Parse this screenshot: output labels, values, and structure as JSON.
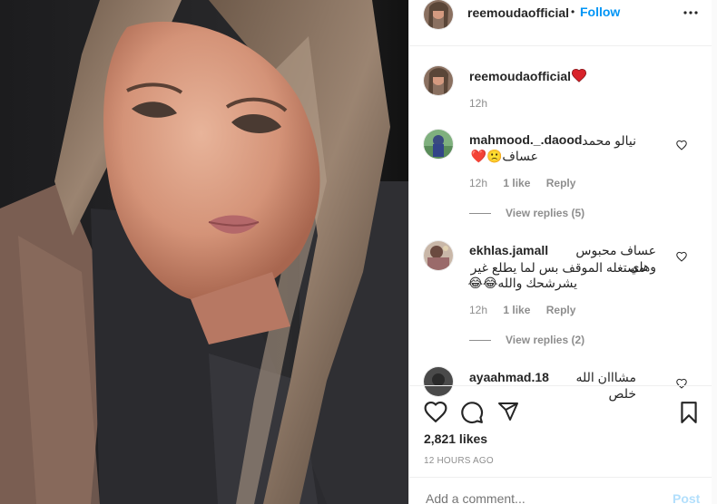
{
  "post": {
    "username": "reemoudaofficial",
    "follow_dot": "•",
    "follow_label": "Follow",
    "more_icon": "more-horizontal-icon"
  },
  "caption": {
    "username": "reemoudaofficial",
    "emoji": "❤️",
    "time": "12h"
  },
  "comments": [
    {
      "username": "mahmood._.daood",
      "text_line1": "نيالو محمد",
      "text_line2": "عساف🙁❤️",
      "time": "12h",
      "likes": "1 like",
      "reply": "Reply",
      "view_replies": "View replies (5)"
    },
    {
      "username": "ekhlas.jamall",
      "text_line1": "عساف محبوس وهاي",
      "text_line2": "مستغله الموقف بس لما يطلع غير",
      "text_line3": "يشرشحك والله😂😂",
      "time": "12h",
      "likes": "1 like",
      "reply": "Reply",
      "view_replies": "View replies (2)"
    },
    {
      "username": "ayaahmad.18",
      "text_line1": "مشااان الله خلص"
    }
  ],
  "actions": {
    "like_icon": "heart-icon",
    "comment_icon": "comment-icon",
    "share_icon": "send-icon",
    "save_icon": "bookmark-icon",
    "likes_count": "2,821 likes",
    "posted_time": "12 HOURS AGO"
  },
  "add_comment": {
    "placeholder": "Add a comment...",
    "post_label": "Post"
  },
  "colors": {
    "accent": "#0095f6",
    "heart": "#ed4956",
    "muted": "#8e8e8e"
  }
}
